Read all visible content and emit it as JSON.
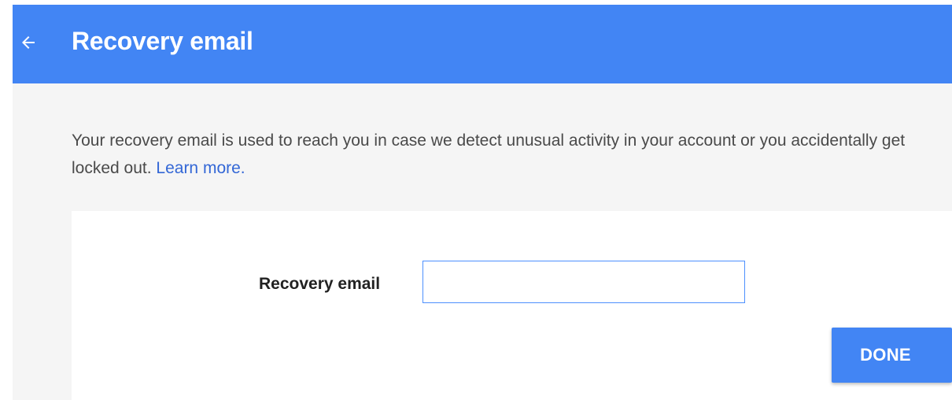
{
  "header": {
    "back_icon": "arrow-back-icon",
    "title": "Recovery email",
    "background_color": "#4285f4"
  },
  "description": {
    "text": "Your recovery email is used to reach you in case we detect unusual activity in your account or you accidentally get locked out.",
    "link_label": "Learn more."
  },
  "form": {
    "recovery_email_label": "Recovery email",
    "recovery_email_value": "",
    "recovery_email_placeholder": "",
    "done_label": "DONE"
  },
  "colors": {
    "accent": "#4285f4",
    "link": "#3367d6",
    "input_border": "#4d90fe"
  }
}
